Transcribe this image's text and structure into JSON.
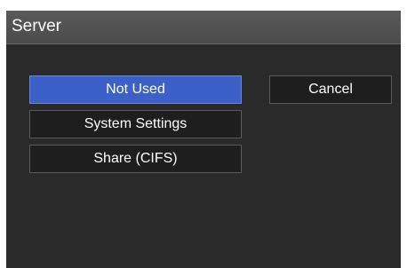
{
  "dialog": {
    "title": "Server"
  },
  "options": [
    {
      "label": "Not Used",
      "selected": true
    },
    {
      "label": "System Settings",
      "selected": false
    },
    {
      "label": "Share (CIFS)",
      "selected": false
    }
  ],
  "cancel_label": "Cancel",
  "colors": {
    "background": "#2a2a2a",
    "titlebar": "#4f4f4f",
    "selected": "#3b60c8",
    "button": "#1e1e1e"
  }
}
